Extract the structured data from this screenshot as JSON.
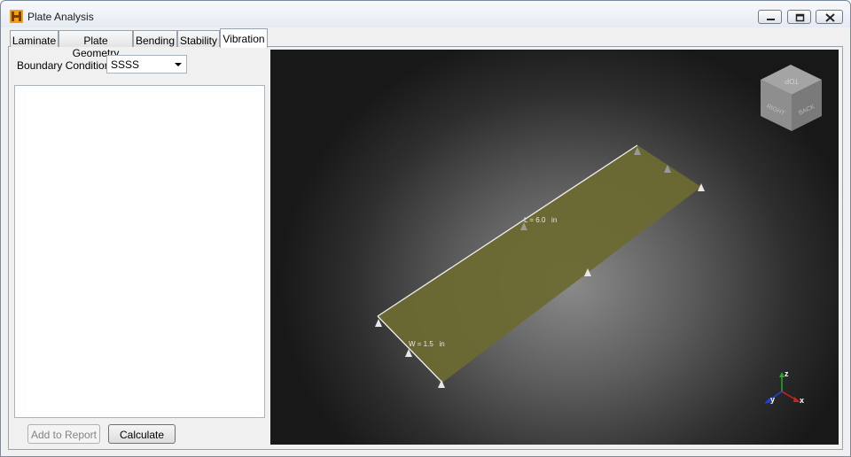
{
  "window": {
    "title": "Plate Analysis"
  },
  "tabs": [
    {
      "label": "Laminate"
    },
    {
      "label": "Plate Geometry"
    },
    {
      "label": "Bending"
    },
    {
      "label": "Stability"
    },
    {
      "label": "Vibration",
      "active": true
    }
  ],
  "vibration": {
    "boundary_condition_label": "Boundary Condition",
    "boundary_condition_value": "SSSS",
    "add_to_report_label": "Add to Report",
    "calculate_label": "Calculate"
  },
  "viewport": {
    "length_label": "L = 6.0   in",
    "width_label": "W = 1.5   in",
    "cube_faces": {
      "top": "TOP",
      "right": "RIGHT",
      "back": "BACK"
    },
    "axes": {
      "x": "x",
      "y": "y",
      "z": "z"
    },
    "plate_color": "#6d6a32",
    "axis_colors": {
      "x": "#d02020",
      "y": "#2040e0",
      "z": "#20b020"
    }
  }
}
